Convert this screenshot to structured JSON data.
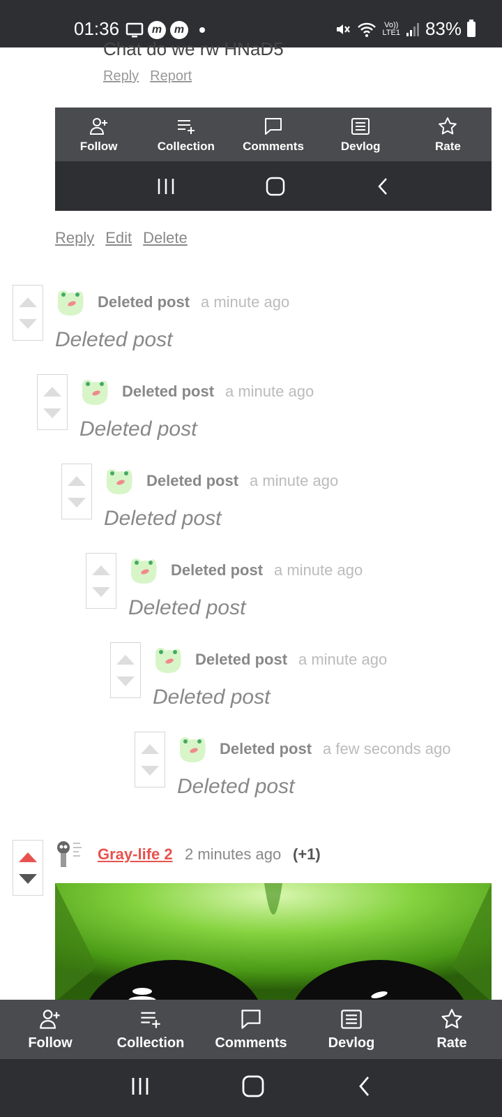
{
  "status_bar": {
    "time": "01:36",
    "battery": "83%",
    "network_top": "Vo))",
    "network_bottom": "LTE1",
    "m_icon": "m"
  },
  "top_comment": {
    "cutoff_text": "Chat do we rw HNaD5",
    "actions": [
      "Reply",
      "Report"
    ]
  },
  "embedded_toolbar": {
    "items": [
      {
        "label": "Follow",
        "icon": "follow-icon"
      },
      {
        "label": "Collection",
        "icon": "collection-icon"
      },
      {
        "label": "Comments",
        "icon": "comments-icon"
      },
      {
        "label": "Devlog",
        "icon": "devlog-icon"
      },
      {
        "label": "Rate",
        "icon": "rate-icon"
      }
    ]
  },
  "own_actions": [
    "Reply",
    "Edit",
    "Delete"
  ],
  "deleted_comments": [
    {
      "author": "Deleted post",
      "time": "a minute ago",
      "body": "Deleted post"
    },
    {
      "author": "Deleted post",
      "time": "a minute ago",
      "body": "Deleted post"
    },
    {
      "author": "Deleted post",
      "time": "a minute ago",
      "body": "Deleted post"
    },
    {
      "author": "Deleted post",
      "time": "a minute ago",
      "body": "Deleted post"
    },
    {
      "author": "Deleted post",
      "time": "a minute ago",
      "body": "Deleted post"
    },
    {
      "author": "Deleted post",
      "time": "a few seconds ago",
      "body": "Deleted post"
    }
  ],
  "gray_life_comment": {
    "author": "Gray-life 2",
    "time": "2 minutes ago",
    "score": "(+1)"
  },
  "bottom_toolbar": {
    "items": [
      {
        "label": "Follow",
        "icon": "follow-icon"
      },
      {
        "label": "Collection",
        "icon": "collection-icon"
      },
      {
        "label": "Comments",
        "icon": "comments-icon"
      },
      {
        "label": "Devlog",
        "icon": "devlog-icon"
      },
      {
        "label": "Rate",
        "icon": "rate-icon"
      }
    ]
  },
  "colors": {
    "accent_red": "#e8524e",
    "toolbar_bg": "#4a4b4e",
    "nav_bg": "#2e2f32",
    "frog_green": "#d8f5c8"
  }
}
